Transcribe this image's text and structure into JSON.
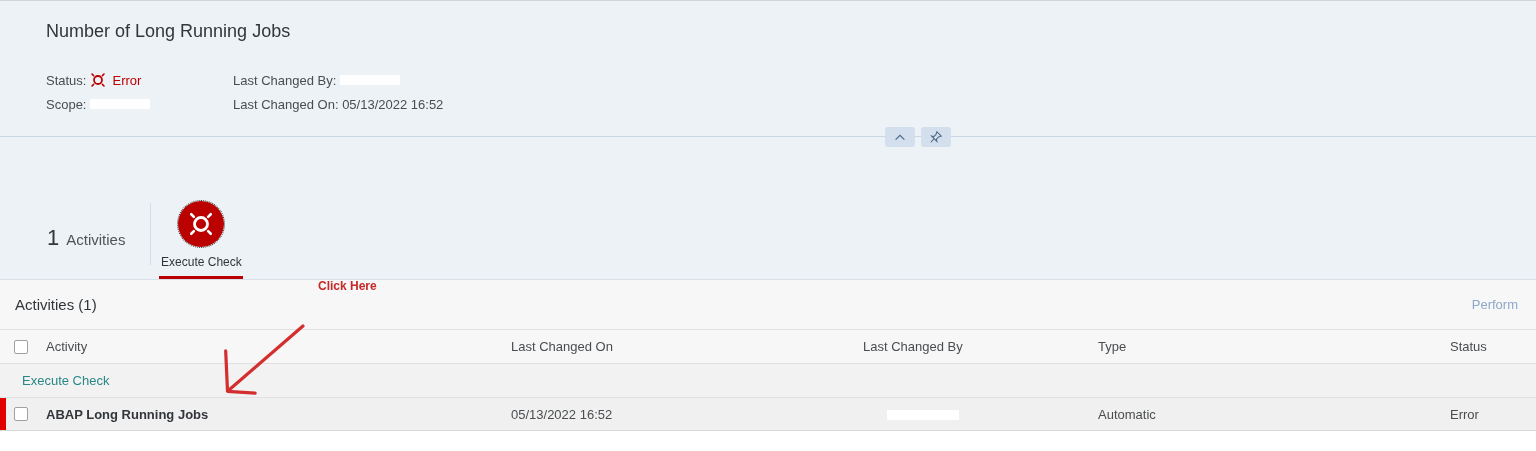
{
  "header": {
    "title": "Number of Long Running Jobs",
    "fields": [
      {
        "label": "Status:",
        "value": "Error",
        "kind": "error"
      },
      {
        "label": "Last Changed By:",
        "redacted": true
      },
      {
        "label": "Scope:",
        "redacted": true
      },
      {
        "label": "Last Changed On: 05/13/2022 16:52"
      }
    ],
    "buttons": [
      {
        "kind": "collapse"
      },
      {
        "kind": "pin"
      }
    ]
  },
  "activity_count": {
    "number": "1",
    "label": "Activities"
  },
  "tabs": [
    {
      "label": "Execute Check",
      "kind": "error",
      "selected": true
    }
  ],
  "table": {
    "title": "Activities (1)",
    "action": "Perform",
    "select_all_checked": false,
    "columns": [
      "Activity",
      "Last Changed On",
      "Last Changed By",
      "Type",
      "Status"
    ],
    "groups": [
      {
        "title": "Execute Check",
        "rows": [
          {
            "activity": "ABAP Long Running Jobs",
            "last_changed_on": "05/13/2022 16:52",
            "last_changed_by_redacted": true,
            "type": "Automatic",
            "status": "Error",
            "checked": false,
            "kind": "error"
          }
        ]
      }
    ]
  },
  "annotation": {
    "text": "Click Here"
  }
}
